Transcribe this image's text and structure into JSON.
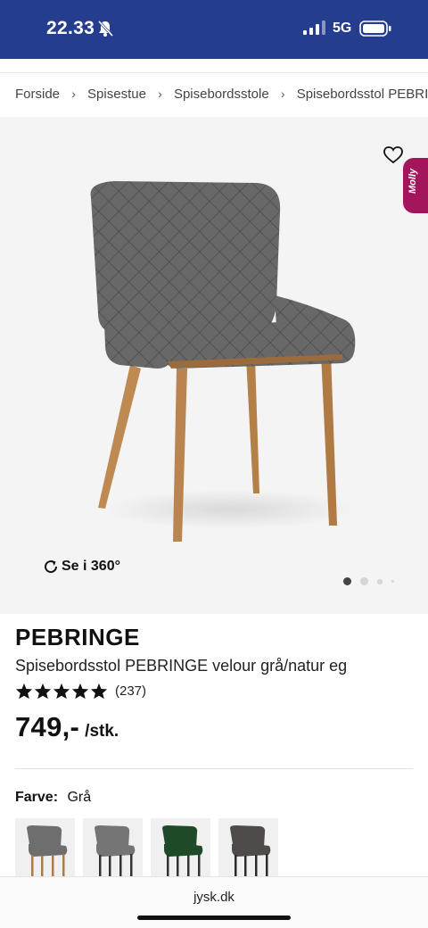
{
  "status_bar": {
    "time": "22.33",
    "network": "5G",
    "icons": [
      "bell-muted-icon",
      "signal-icon",
      "battery-icon"
    ]
  },
  "breadcrumb": {
    "items": [
      "Forside",
      "Spisestue",
      "Spisebordsstole",
      "Spisebordsstol PEBRINGE velour grå/natur eg"
    ]
  },
  "gallery": {
    "view360_label": "Se i 360°",
    "slide_count": 4,
    "active_slide": 1,
    "chat_tab_label": "Molly",
    "icons": [
      "heart-icon",
      "rotate-icon"
    ]
  },
  "product": {
    "name": "PEBRINGE",
    "description": "Spisebordsstol PEBRINGE velour grå/natur eg",
    "rating_stars": 5,
    "rating_count": "(237)",
    "price": "749,-",
    "price_unit": "/stk."
  },
  "color": {
    "label": "Farve:",
    "value": "Grå",
    "swatches": [
      {
        "name": "grå-natur",
        "seat": "#6e6e6e",
        "legs": "#b07a45"
      },
      {
        "name": "grå-sort",
        "seat": "#757575",
        "legs": "#333333"
      },
      {
        "name": "grøn-sort",
        "seat": "#1f4a2a",
        "legs": "#333333"
      },
      {
        "name": "mørkegrå-sort",
        "seat": "#4f4b4a",
        "legs": "#2b2b2b"
      }
    ]
  },
  "browser": {
    "url": "jysk.dk"
  },
  "colors": {
    "status_bar": "#243d8f",
    "chat_tab": "#a3165c"
  }
}
